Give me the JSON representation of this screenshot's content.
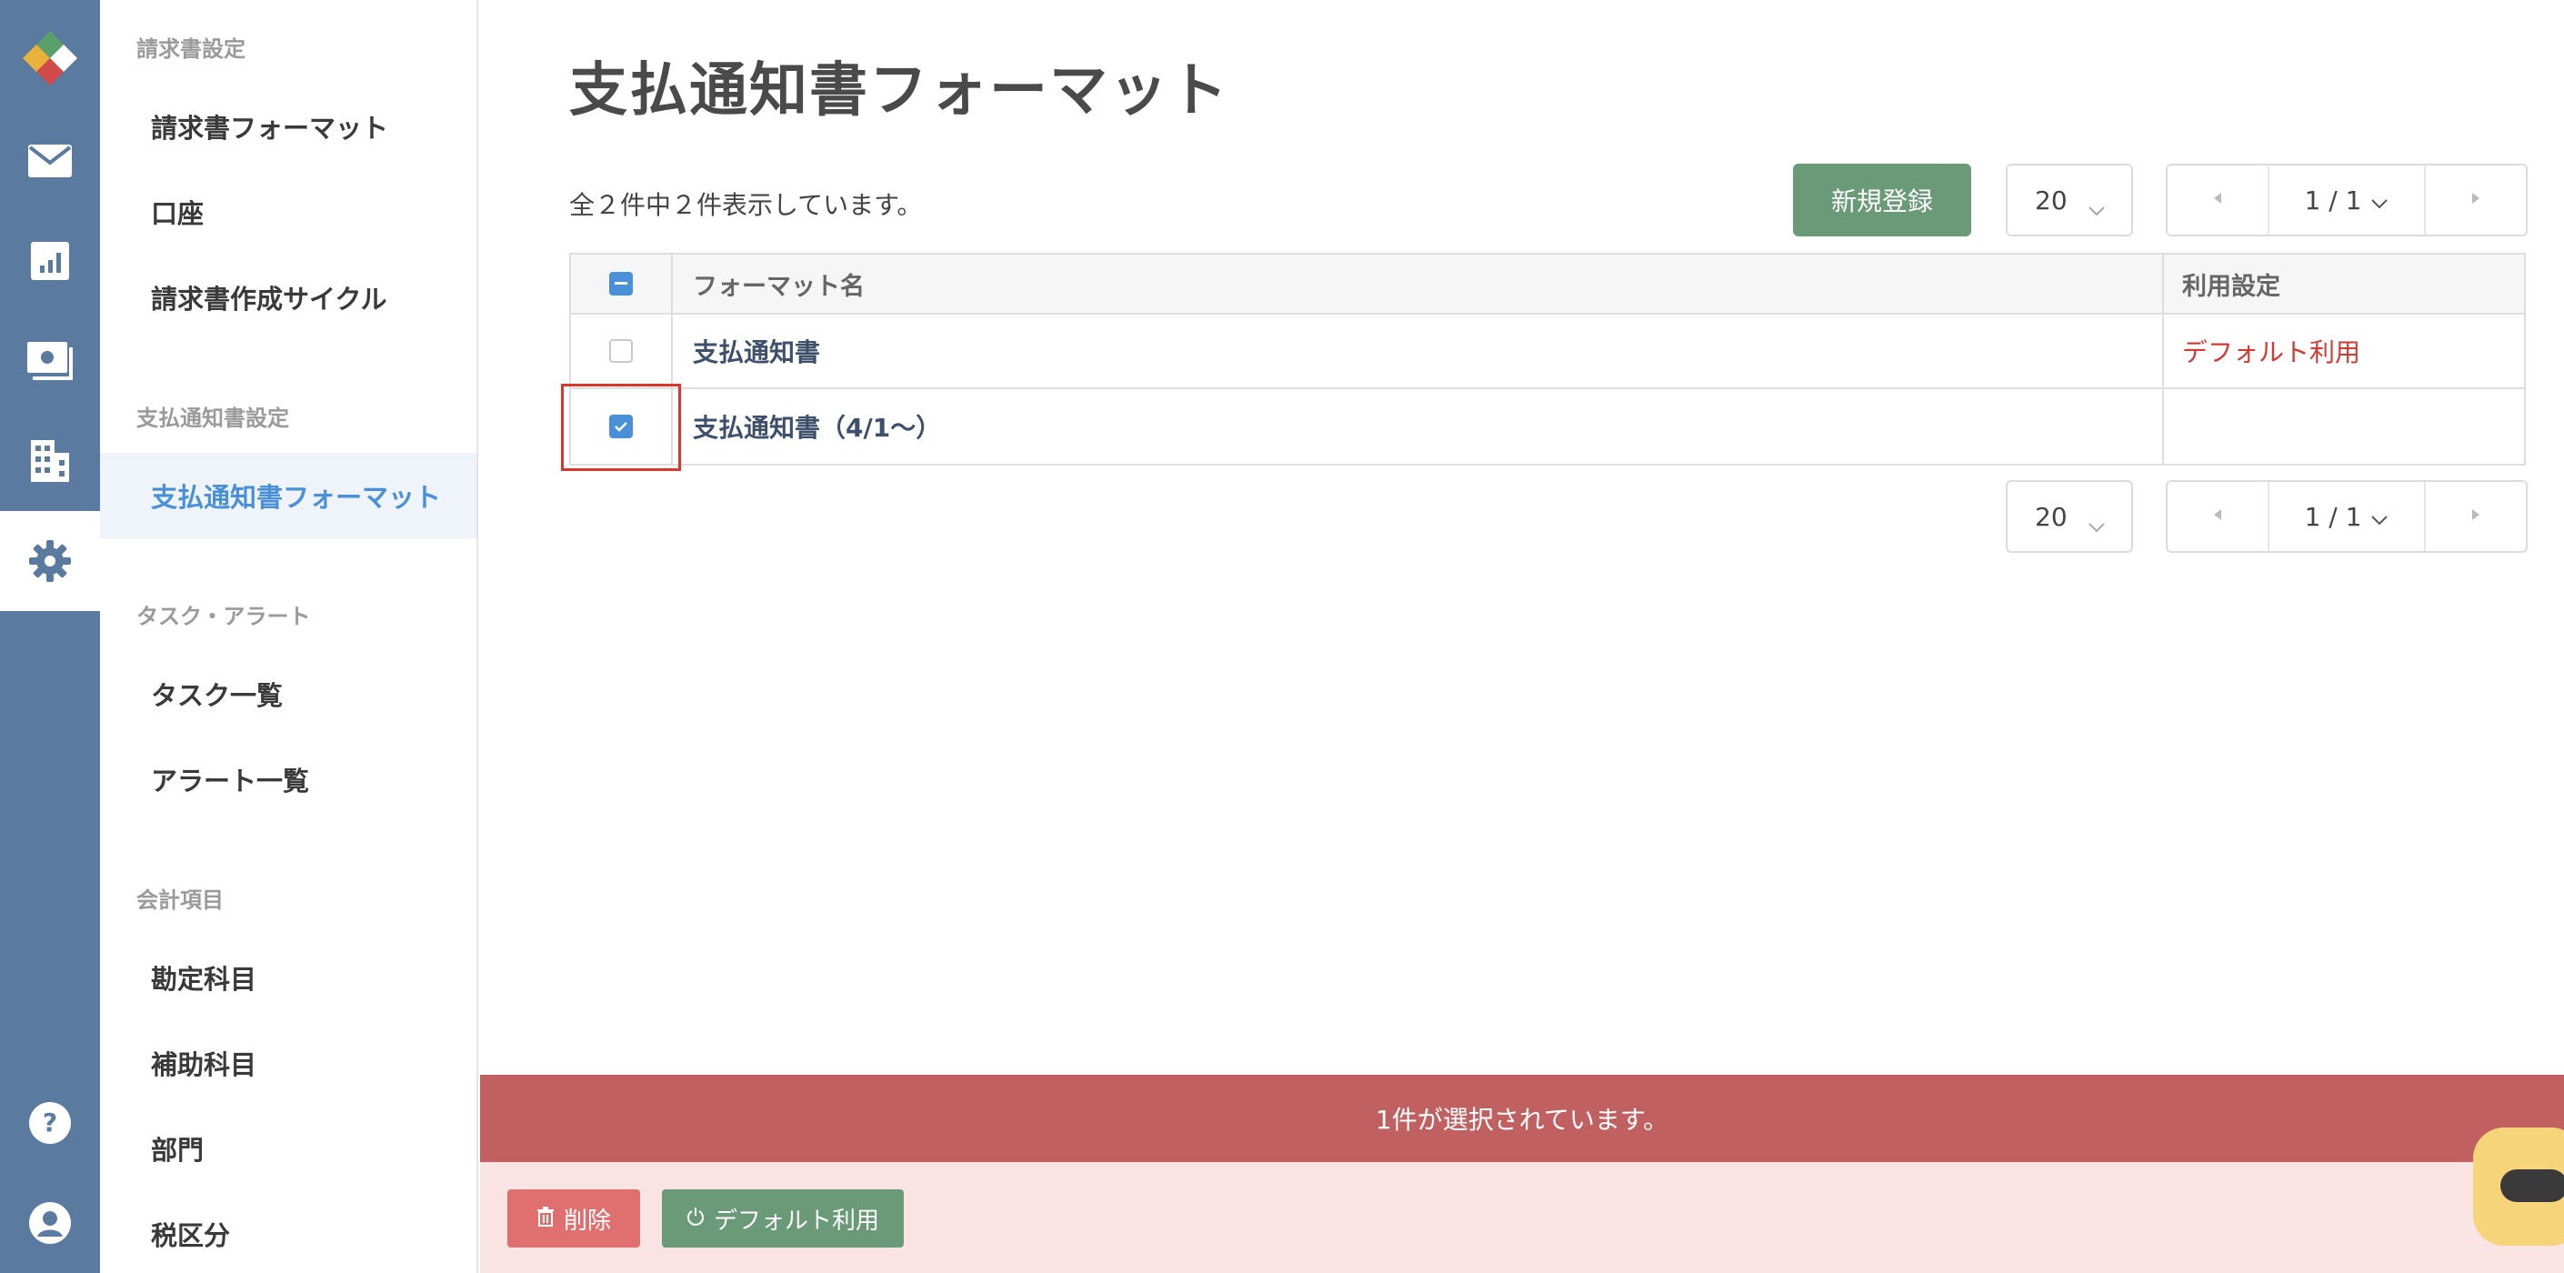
{
  "page": {
    "title": "支払通知書フォーマット",
    "count_text": "全２件中２件表示しています。"
  },
  "sidebar": {
    "sections": [
      {
        "label": "請求書設定",
        "items": [
          "請求書フォーマット",
          "口座",
          "請求書作成サイクル"
        ]
      },
      {
        "label": "支払通知書設定",
        "items": [
          "支払通知書フォーマット"
        ]
      },
      {
        "label": "タスク・アラート",
        "items": [
          "タスク一覧",
          "アラート一覧"
        ]
      },
      {
        "label": "会計項目",
        "items": [
          "勘定科目",
          "補助科目",
          "部門",
          "税区分"
        ]
      }
    ],
    "active_item": "支払通知書フォーマット"
  },
  "toolbar": {
    "new_button": "新規登録",
    "per_page": "20",
    "page_indicator": "1 / 1"
  },
  "table": {
    "columns": [
      "フォーマット名",
      "利用設定"
    ],
    "rows": [
      {
        "name": "支払通知書",
        "usage": "デフォルト利用",
        "checked": false
      },
      {
        "name": "支払通知書（4/1〜）",
        "usage": "",
        "checked": true
      }
    ]
  },
  "footer_pager": {
    "per_page": "20",
    "page_indicator": "1 / 1"
  },
  "selection_bar": {
    "message": "1件が選択されています。",
    "delete_button": "削除",
    "default_button": "デフォルト利用"
  },
  "colors": {
    "rail": "#5a7aa0",
    "accent_blue": "#4a90d9",
    "primary_green": "#6b9a78",
    "danger_red": "#c06060",
    "default_text_red": "#d03a32"
  },
  "icons": {
    "rail": [
      "logo",
      "mail-icon",
      "chart-icon",
      "payment-icon",
      "building-icon",
      "gear-icon",
      "help-icon",
      "user-icon"
    ]
  }
}
